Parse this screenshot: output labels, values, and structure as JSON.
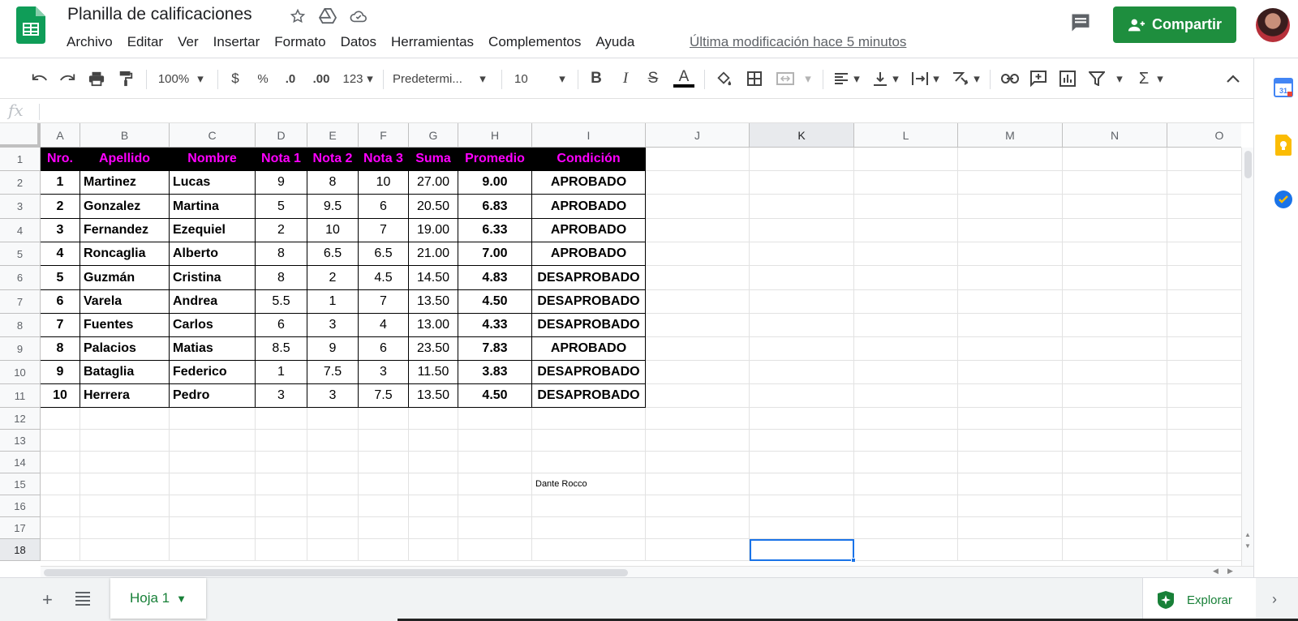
{
  "app": {
    "title": "Planilla de calificaciones",
    "menu": [
      "Archivo",
      "Editar",
      "Ver",
      "Insertar",
      "Formato",
      "Datos",
      "Herramientas",
      "Complementos",
      "Ayuda"
    ],
    "last_modified": "Última modificación hace 5 minutos",
    "share_label": "Compartir",
    "accent_color": "#1e8e3e"
  },
  "toolbar": {
    "zoom": "100%",
    "currency": "$",
    "percent": "%",
    "dec_less": ".0",
    "dec_more": ".00",
    "more_formats": "123",
    "font": "Predetermi...",
    "font_size": "10",
    "bold": "B",
    "italic": "I",
    "strike": "S",
    "text_color": "A"
  },
  "formula_bar": {
    "fx": "fx"
  },
  "grid": {
    "columns": [
      "A",
      "B",
      "C",
      "D",
      "E",
      "F",
      "G",
      "H",
      "I",
      "J",
      "K",
      "L",
      "M",
      "N",
      "O"
    ],
    "rows": [
      "1",
      "2",
      "3",
      "4",
      "5",
      "6",
      "7",
      "8",
      "9",
      "10",
      "11",
      "12",
      "13",
      "14",
      "15",
      "16",
      "17",
      "18"
    ],
    "selected_cell": "K18",
    "header_color": "#ff00ff",
    "table_header": [
      "Nro.",
      "Apellido",
      "Nombre",
      "Nota 1",
      "Nota 2",
      "Nota 3",
      "Suma",
      "Promedio",
      "Condición"
    ],
    "table_rows": [
      [
        "1",
        "Martinez",
        "Lucas",
        "9",
        "8",
        "10",
        "27.00",
        "9.00",
        "APROBADO"
      ],
      [
        "2",
        "Gonzalez",
        "Martina",
        "5",
        "9.5",
        "6",
        "20.50",
        "6.83",
        "APROBADO"
      ],
      [
        "3",
        "Fernandez",
        "Ezequiel",
        "2",
        "10",
        "7",
        "19.00",
        "6.33",
        "APROBADO"
      ],
      [
        "4",
        "Roncaglia",
        "Alberto",
        "8",
        "6.5",
        "6.5",
        "21.00",
        "7.00",
        "APROBADO"
      ],
      [
        "5",
        "Guzmán",
        "Cristina",
        "8",
        "2",
        "4.5",
        "14.50",
        "4.83",
        "DESAPROBADO"
      ],
      [
        "6",
        "Varela",
        "Andrea",
        "5.5",
        "1",
        "7",
        "13.50",
        "4.50",
        "DESAPROBADO"
      ],
      [
        "7",
        "Fuentes",
        "Carlos",
        "6",
        "3",
        "4",
        "13.00",
        "4.33",
        "DESAPROBADO"
      ],
      [
        "8",
        "Palacios",
        "Matias",
        "8.5",
        "9",
        "6",
        "23.50",
        "7.83",
        "APROBADO"
      ],
      [
        "9",
        "Bataglia",
        "Federico",
        "1",
        "7.5",
        "3",
        "11.50",
        "3.83",
        "DESAPROBADO"
      ],
      [
        "10",
        "Herrera",
        "Pedro",
        "3",
        "3",
        "7.5",
        "13.50",
        "4.50",
        "DESAPROBADO"
      ]
    ],
    "note_cell": "I15",
    "note_text": "Dante Rocco"
  },
  "footer": {
    "add_sheet": "+",
    "sheet_tab": "Hoja 1",
    "explore_label": "Explorar"
  }
}
